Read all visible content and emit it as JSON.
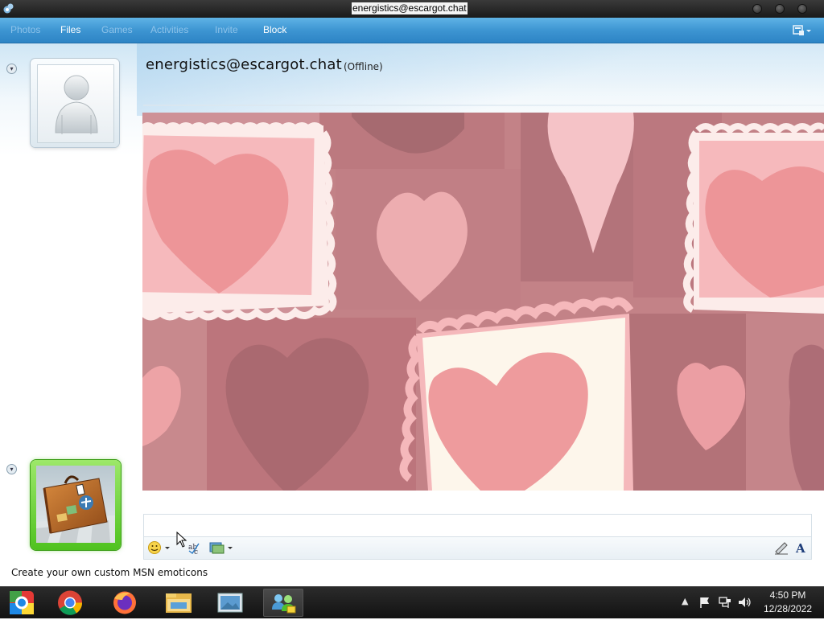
{
  "window": {
    "title": "energistics@escargot.chat"
  },
  "toolbar": {
    "items": [
      {
        "label": "Photos",
        "enabled": false
      },
      {
        "label": "Files",
        "enabled": true
      },
      {
        "label": "Games",
        "enabled": false
      },
      {
        "label": "Activities",
        "enabled": false
      },
      {
        "label": "Invite",
        "enabled": false
      },
      {
        "label": "Block",
        "enabled": true
      }
    ],
    "menu_icon": "show-menu-icon"
  },
  "contact": {
    "name": "energistics@escargot.chat",
    "status": "(Offline)",
    "avatar_icon": "default-user-avatar"
  },
  "conversation": {
    "background": "valentine-hearts-scene",
    "messages": []
  },
  "my_picture": {
    "icon": "suitcase-avatar"
  },
  "input": {
    "value": "",
    "tools": [
      "emoticon-icon",
      "spellcheck-icon",
      "send-file-icon",
      "handwriting-icon",
      "font-icon"
    ]
  },
  "status_tip": "Create your own custom MSN emoticons",
  "taskbar": {
    "apps": [
      "start-icon",
      "chrome-icon",
      "firefox-icon",
      "file-explorer-icon",
      "photo-viewer-icon",
      "messenger-icon"
    ],
    "active_app": "messenger-icon",
    "tray": [
      "show-hidden-icons-icon",
      "action-center-flag-icon",
      "network-icon",
      "volume-icon"
    ],
    "time": "4:50 PM",
    "date": "12/28/2022"
  },
  "colors": {
    "toolbar": "#3d95d2",
    "conversation_bg": "#b56168",
    "my_frame": "#4fc21f",
    "taskbar": "#1a1a1a"
  }
}
